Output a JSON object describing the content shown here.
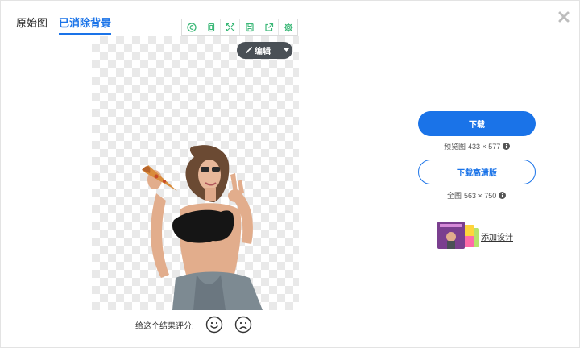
{
  "tabs": [
    {
      "label": "原始图",
      "active": false
    },
    {
      "label": "已消除背景",
      "active": true
    }
  ],
  "toolbar": {
    "tools": [
      "copyright-icon",
      "copy-icon",
      "fullscreen-icon",
      "save-icon",
      "share-icon",
      "settings-icon"
    ]
  },
  "editor": {
    "edit_label": "编辑"
  },
  "rating": {
    "prompt": "给这个结果评分:"
  },
  "download": {
    "primary_label": "下载",
    "preview_label": "预览图",
    "preview_size": "433 × 577",
    "hd_label": "下载高清版",
    "full_label": "全图",
    "full_size": "563 × 750"
  },
  "design": {
    "link_label": "添加设计"
  },
  "colors": {
    "accent": "#1a73e8",
    "edit_button": "#4a5056",
    "toolbar_icon": "#3cb878"
  }
}
